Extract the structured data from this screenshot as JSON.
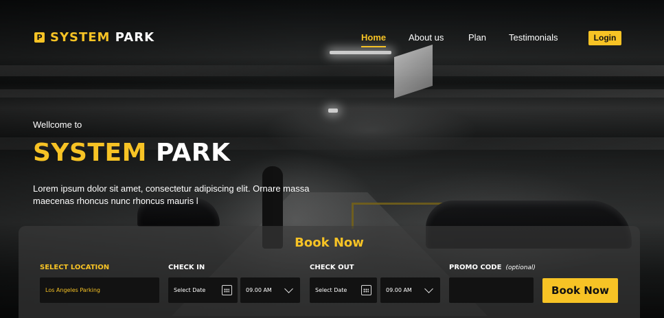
{
  "brand": {
    "part1": "SYSTEM",
    "part2": "PARK",
    "icon": "P"
  },
  "nav": {
    "items": [
      {
        "label": "Home",
        "active": true
      },
      {
        "label": "About us",
        "active": false
      },
      {
        "label": "Plan",
        "active": false
      },
      {
        "label": "Testimonials",
        "active": false
      }
    ],
    "login_label": "Login"
  },
  "hero": {
    "welcome": "Wellcome to",
    "title_part1": "SYSTEM",
    "title_part2": "PARK",
    "description": "Lorem ipsum dolor sit amet, consectetur adipiscing elit. Ornare massa maecenas rhoncus nunc rhoncus mauris l"
  },
  "booking": {
    "title": "Book Now",
    "location_label": "SELECT LOCATION",
    "location_value": "Los Angeles Parking",
    "checkin_label": "CHECK IN",
    "checkin_date": "Select Date",
    "checkin_time": "09.00 AM",
    "checkout_label": "CHECK OUT",
    "checkout_date": "Select Date",
    "checkout_time": "09.00 AM",
    "promo_label": "PROMO CODE",
    "promo_optional": "(optional)",
    "promo_value": "",
    "submit_label": "Book Now"
  },
  "colors": {
    "accent": "#f7c325",
    "field_bg": "#121212"
  }
}
